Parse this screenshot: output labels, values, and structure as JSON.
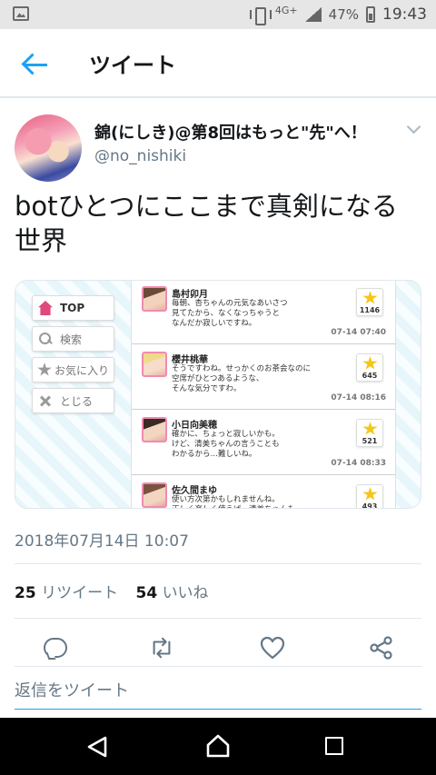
{
  "status_bar": {
    "network": "4G+",
    "battery": "47%",
    "time": "19:43"
  },
  "header": {
    "title": "ツイート"
  },
  "tweet": {
    "user_name": "錦(にしき)@第8回はもっと\"先\"へ！",
    "handle": "@no_nishiki",
    "text": "botひとつにここまで真剣になる世界",
    "date": "2018年07月14日 10:07",
    "retweet_count": "25",
    "retweet_label": "リツイート",
    "like_count": "54",
    "like_label": "いいね"
  },
  "media": {
    "nav": [
      {
        "label": "TOP",
        "icon": "home-icon"
      },
      {
        "label": "検索",
        "icon": "search-icon"
      },
      {
        "label": "お気に入り",
        "icon": "star-icon"
      },
      {
        "label": "とじる",
        "icon": "close-icon"
      }
    ],
    "items": [
      {
        "name": "島村卯月",
        "message": "毎朝、杏ちゃんの元気なあいさつ\n見てたから、なくなっちゃうと\nなんだか寂しいですね。",
        "favs": "1146",
        "time": "07-14 07:40"
      },
      {
        "name": "櫻井桃華",
        "message": "そうですわね。せっかくのお茶会なのに\n空席がひとつあるような、\nそんな気分ですわ。",
        "favs": "645",
        "time": "07-14 08:16"
      },
      {
        "name": "小日向美穂",
        "message": "確かに、ちょっと寂しいかも。\nけど、清美ちゃんの言うことも\nわかるから…難しいね。",
        "favs": "521",
        "time": "07-14 08:33"
      },
      {
        "name": "佐久間まゆ",
        "message": "使い方次第かもしれませんね。\n正しく楽しく使えば、清美ちゃんも",
        "favs": "493",
        "time": ""
      }
    ]
  },
  "reply": {
    "placeholder": "返信をツイート"
  },
  "colors": {
    "accent": "#1da1f2",
    "secondary_text": "#657786",
    "divider": "#e1e8ed"
  }
}
